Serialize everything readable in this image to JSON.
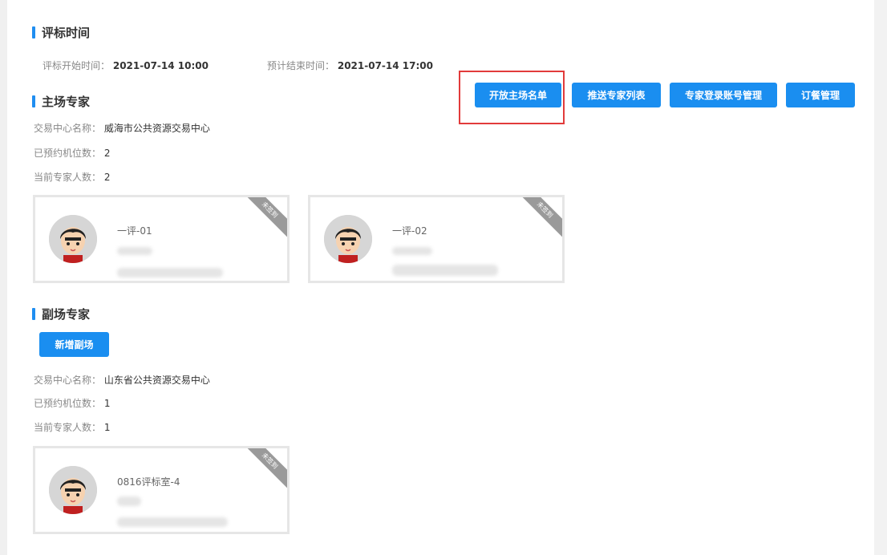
{
  "bid_time": {
    "title": "评标时间",
    "start_label": "评标开始时间：",
    "start_value": "2021-07-14 10:00",
    "end_label": "预计结束时间：",
    "end_value": "2021-07-14 17:00"
  },
  "toolbar": {
    "open_list": "开放主场名单",
    "push_experts": "推送专家列表",
    "login_accounts": "专家登录账号管理",
    "meal_mgmt": "订餐管理"
  },
  "main_venue": {
    "title": "主场专家",
    "center_label": "交易中心名称：",
    "center_value": "威海市公共资源交易中心",
    "seats_label": "已预约机位数：",
    "seats_value": "2",
    "experts_label": "当前专家人数：",
    "experts_value": "2",
    "cards": [
      {
        "name": "一评-01",
        "status": "未签到"
      },
      {
        "name": "一评-02",
        "status": "未签到"
      }
    ]
  },
  "sub_venue": {
    "title": "副场专家",
    "add_button": "新增副场",
    "center_label": "交易中心名称：",
    "center_value": "山东省公共资源交易中心",
    "seats_label": "已预约机位数：",
    "seats_value": "1",
    "experts_label": "当前专家人数：",
    "experts_value": "1",
    "cards": [
      {
        "name": "0816评标室-4",
        "status": "未签到"
      }
    ]
  },
  "colors": {
    "accent": "#1a8ef0",
    "highlight": "#e23b3b",
    "ribbon": "#9a9a9a"
  }
}
